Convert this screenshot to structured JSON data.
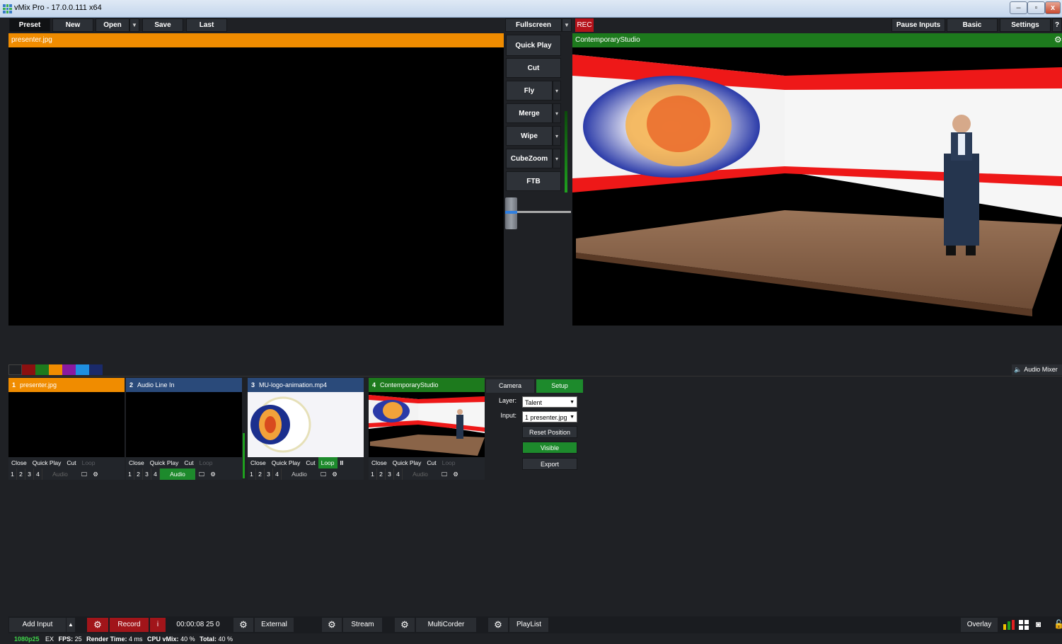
{
  "window": {
    "title": "vMix Pro - 17.0.0.111 x64"
  },
  "toolbar": {
    "preset": "Preset",
    "new": "New",
    "open": "Open",
    "save": "Save",
    "last": "Last",
    "fullscreen": "Fullscreen",
    "rec": "REC",
    "pause_inputs": "Pause Inputs",
    "basic": "Basic",
    "settings": "Settings",
    "help": "?"
  },
  "preview": {
    "title": "presenter.jpg"
  },
  "output": {
    "title": "ContemporaryStudio"
  },
  "transitions": [
    "Quick Play",
    "Cut",
    "Fly",
    "Merge",
    "Wipe",
    "CubeZoom",
    "FTB"
  ],
  "color_tags": [
    "#1f2125",
    "#8b1010",
    "#1d7a1d",
    "#f08c00",
    "#8a1aa0",
    "#1f8fe0",
    "#1a2a6a"
  ],
  "audio_mixer": "Audio Mixer",
  "inputs": [
    {
      "num": "1",
      "name": "presenter.jpg",
      "header_color": "#f08c00",
      "close": "Close",
      "quick_play": "Quick Play",
      "cut": "Cut",
      "loop": "Loop",
      "n1": "1",
      "n2": "2",
      "n3": "3",
      "n4": "4",
      "audio": "Audio"
    },
    {
      "num": "2",
      "name": "Audio Line In",
      "header_color": "#2a4a7a",
      "close": "Close",
      "quick_play": "Quick Play",
      "cut": "Cut",
      "loop": "Loop",
      "n1": "1",
      "n2": "2",
      "n3": "3",
      "n4": "4",
      "audio": "Audio"
    },
    {
      "num": "3",
      "name": "MU-logo-animation.mp4",
      "header_color": "#2a4a7a",
      "close": "Close",
      "quick_play": "Quick Play",
      "cut": "Cut",
      "loop": "Loop",
      "pause": "II",
      "n1": "1",
      "n2": "2",
      "n3": "3",
      "n4": "4",
      "audio": "Audio"
    },
    {
      "num": "4",
      "name": "ContemporaryStudio",
      "header_color": "#1d7a1d",
      "close": "Close",
      "quick_play": "Quick Play",
      "cut": "Cut",
      "loop": "Loop",
      "n1": "1",
      "n2": "2",
      "n3": "3",
      "n4": "4",
      "audio": "Audio"
    }
  ],
  "setup_panel": {
    "camera": "Camera",
    "setup": "Setup",
    "layer_label": "Layer:",
    "layer_value": "Talent",
    "input_label": "Input:",
    "input_value": "1 presenter.jpg",
    "reset_position": "Reset Position",
    "visible": "Visible",
    "export": "Export"
  },
  "bottom": {
    "add_input": "Add Input",
    "record": "Record",
    "info": "i",
    "timecode": "00:00:08 25 0",
    "external": "External",
    "stream": "Stream",
    "multicorder": "MultiCorder",
    "playlist": "PlayList",
    "overlay": "Overlay"
  },
  "status": {
    "format": "1080p25",
    "ex": "EX",
    "fps_label": "FPS:",
    "fps": "25",
    "render_label": "Render Time:",
    "render": "4 ms",
    "cpu_label": "CPU vMix:",
    "cpu": "40 %",
    "total_label": "Total:",
    "total": "40 %"
  }
}
